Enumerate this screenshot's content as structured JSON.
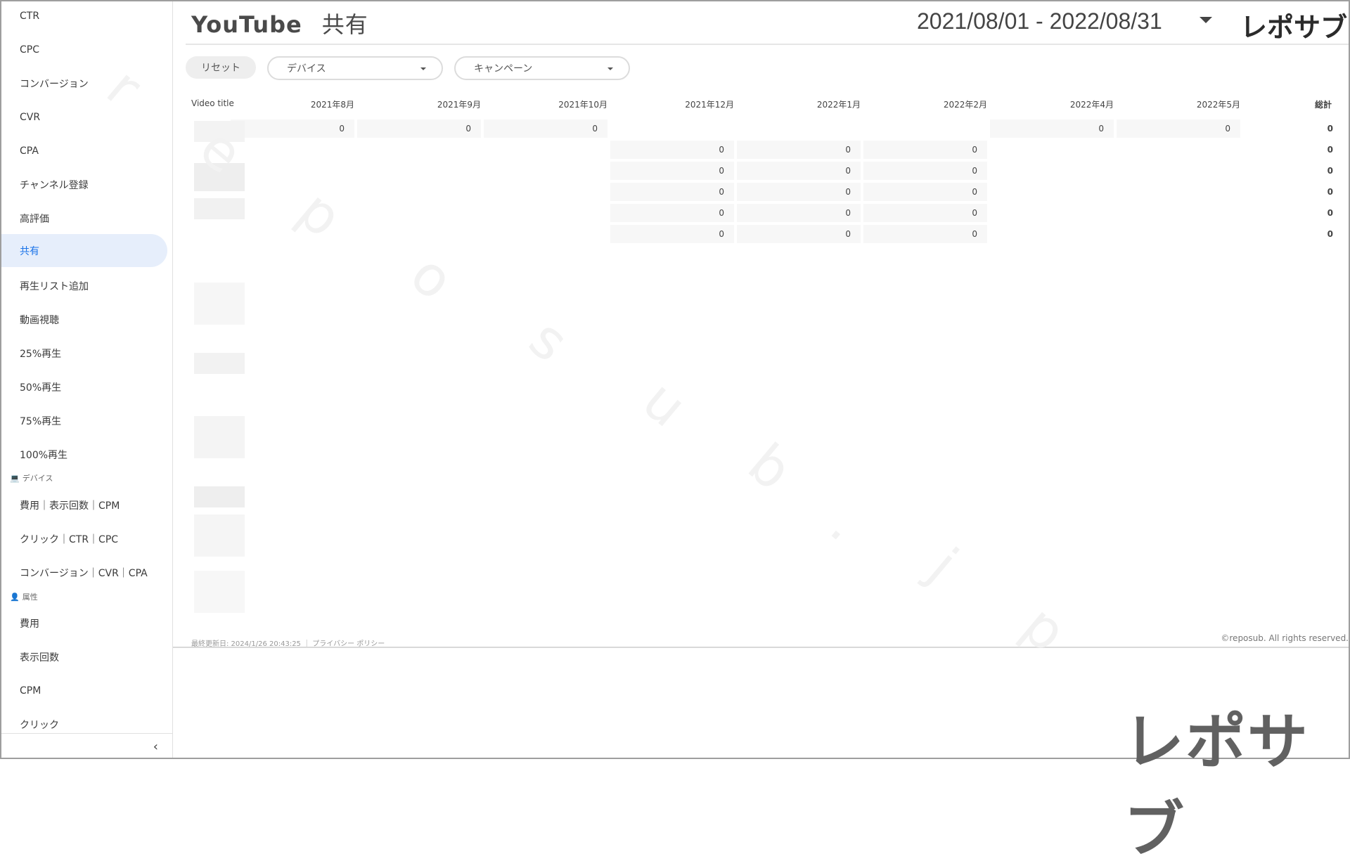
{
  "sidebar": {
    "items": [
      {
        "label": "CTR"
      },
      {
        "label": "CPC"
      },
      {
        "label": "コンバージョン"
      },
      {
        "label": "CVR"
      },
      {
        "label": "CPA"
      },
      {
        "label": "チャンネル登録"
      },
      {
        "label": "高評価"
      },
      {
        "label": "共有",
        "active": true
      },
      {
        "label": "再生リスト追加"
      },
      {
        "label": "動画視聴"
      },
      {
        "label": "25%再生"
      },
      {
        "label": "50%再生"
      },
      {
        "label": "75%再生"
      },
      {
        "label": "100%再生"
      }
    ],
    "device_section": {
      "label": "デバイス",
      "items": [
        {
          "label": "費用｜表示回数｜CPM"
        },
        {
          "label": "クリック｜CTR｜CPC"
        },
        {
          "label": "コンバージョン｜CVR｜CPA"
        }
      ]
    },
    "attribute_section": {
      "label": "属性",
      "items": [
        {
          "label": "費用"
        },
        {
          "label": "表示回数"
        },
        {
          "label": "CPM"
        },
        {
          "label": "クリック"
        }
      ]
    },
    "collapse_icon": "‹"
  },
  "header": {
    "title": "YouTube",
    "subtitle": "共有",
    "date_range": "2021/08/01 - 2022/08/31",
    "logo": "レポサブ"
  },
  "filters": {
    "reset_label": "リセット",
    "device_select": "デバイス",
    "campaign_select": "キャンペーン"
  },
  "table": {
    "first_col_header": "Video title",
    "columns": [
      "2021年8月",
      "2021年9月",
      "2021年10月",
      "2021年12月",
      "2022年1月",
      "2022年2月",
      "2022年4月",
      "2022年5月"
    ],
    "total_header": "総計",
    "rows": [
      {
        "title": "",
        "values": [
          "0",
          "0",
          "0",
          "",
          "",
          "",
          "0",
          "0"
        ],
        "total": "0"
      },
      {
        "title": "",
        "values": [
          "",
          "",
          "",
          "0",
          "0",
          "0",
          "",
          ""
        ],
        "total": "0"
      },
      {
        "title": "",
        "values": [
          "",
          "",
          "",
          "0",
          "0",
          "0",
          "",
          ""
        ],
        "total": "0"
      },
      {
        "title": "",
        "values": [
          "",
          "",
          "",
          "0",
          "0",
          "0",
          "",
          ""
        ],
        "total": "0"
      },
      {
        "title": "",
        "values": [
          "",
          "",
          "",
          "0",
          "0",
          "0",
          "",
          ""
        ],
        "total": "0"
      },
      {
        "title": "",
        "values": [
          "",
          "",
          "",
          "0",
          "0",
          "0",
          "",
          ""
        ],
        "total": "0"
      }
    ]
  },
  "footer": {
    "last_updated": "最終更新日: 2024/1/26 20:43:25",
    "privacy_link": "プライバシー ポリシー",
    "copyright": "©reposub. All rights reserved."
  },
  "watermark": {
    "chars": [
      "r",
      "e",
      "p",
      "o",
      "s",
      "u",
      "b",
      ".",
      "j",
      "p"
    ]
  },
  "brand_logo": "レポサブ"
}
